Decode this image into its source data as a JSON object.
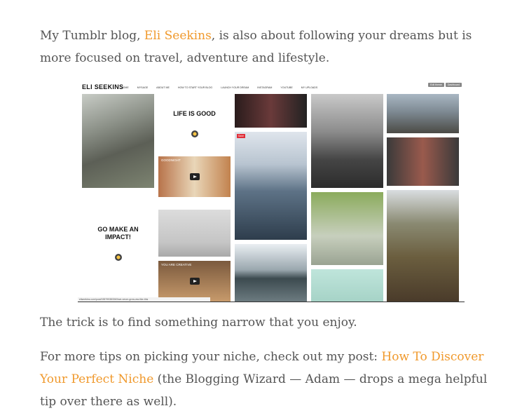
{
  "para1": {
    "before": "My Tumblr blog, ",
    "link": "Eli Seekins",
    "after": ", is also about following your dreams but is more focused on travel, adventure and lifestyle."
  },
  "screenshot": {
    "logo": "ELI SEEKINS",
    "nav": [
      "HOME",
      "MYSAGE",
      "ABOUT ME",
      "HOW TO START YOUR BLOG",
      "LAUNCH YOUR DREAM",
      "INSTAGRAM",
      "YOUTUBE",
      "MY UPLOADS"
    ],
    "buttons": [
      "Edit theme",
      "Dashboard"
    ],
    "tile_life": "LIFE IS GOOD",
    "tile_impact": "GO MAKE AN IMPACT!",
    "video1": "GOODNIGHT",
    "video2": "YOU ARE CREATIVE",
    "save": "Save",
    "status": "eliseekins.com/post/155799383363/we-never-grow-ww-like-this"
  },
  "para2": "The trick is to find something narrow that you enjoy.",
  "para3": {
    "before": "For more tips on picking your niche, check out my post: ",
    "link": "How To Discover Your Perfect Niche",
    "after": " (the Blogging Wizard — Adam — drops a mega helpful tip over there as well)."
  },
  "colors": {
    "link": "#f0992c",
    "text": "#555555"
  }
}
